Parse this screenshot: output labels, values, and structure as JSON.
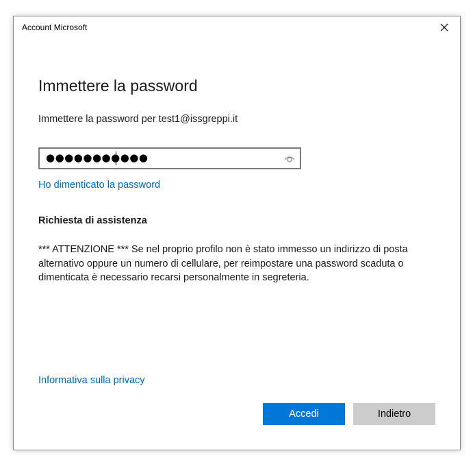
{
  "window": {
    "title": "Account Microsoft",
    "close_label": "✕"
  },
  "form": {
    "heading": "Immettere la password",
    "subheading": "Immettere la password per test1@issgreppi.it",
    "password_masked": "●●●●●●●●●●●",
    "reveal_icon": "eye-icon",
    "forgot_link": "Ho dimenticato la password"
  },
  "help": {
    "title": "Richiesta di assistenza",
    "text": "*** ATTENZIONE *** Se nel proprio profilo non è stato immesso un indirizzo di posta alternativo oppure un numero di cellulare, per reimpostare una password scaduta o dimenticata è necessario recarsi personalmente in segreteria."
  },
  "footer": {
    "privacy_link": "Informativa sulla privacy",
    "primary_button": "Accedi",
    "secondary_button": "Indietro"
  },
  "colors": {
    "accent": "#0078d7",
    "link": "#0067b8",
    "secondary_button": "#cccccc"
  }
}
